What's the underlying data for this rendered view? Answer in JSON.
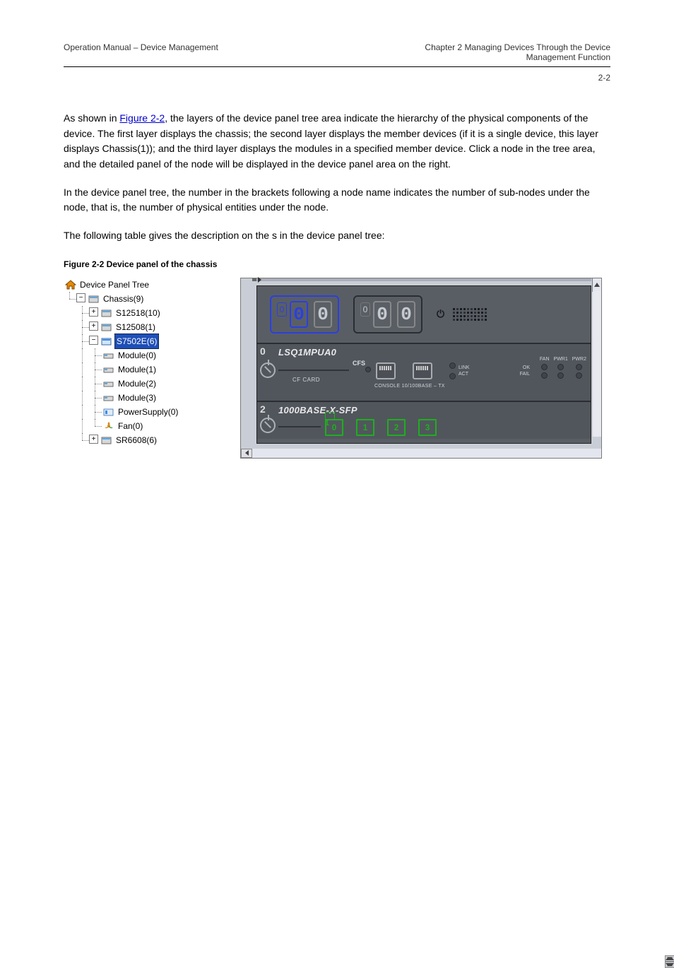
{
  "header": {
    "left": "Operation Manual – Device Management",
    "right_top": "Chapter 2 Managing Devices Through the Device",
    "right_bottom": "Management Function",
    "page": "2-2"
  },
  "paragraphs": {
    "p1_prefix": "As shown in ",
    "p1_link": "Figure 2-2",
    "p1_suffix": ", the layers of the device panel tree area indicate the hierarchy of the physical components of the device. The first layer displays the chassis; the second layer displays the member devices (if it is a single device, this layer displays Chassis(1)); and the third layer displays the modules in a specified member device. Click a node in the tree area, and the detailed panel of the node will be displayed in the device panel area on the right.",
    "p2": "In the device panel tree, the number in the brackets following a node name indicates the number of sub-nodes under the node, that is, the number of physical entities under the node.",
    "p3": "The following table gives the description on the s in the device panel tree:"
  },
  "figure": {
    "caption": "Figure 2-2 Device panel of the chassis",
    "tree": {
      "root": "Device Panel Tree",
      "chassis": "Chassis(9)",
      "members": [
        {
          "label": "S12518(10)",
          "expanded": false
        },
        {
          "label": "S12508(1)",
          "expanded": false
        },
        {
          "label": "S7502E(6)",
          "expanded": true,
          "selected": true,
          "children": [
            "Module(0)",
            "Module(1)",
            "Module(2)",
            "Module(3)",
            "PowerSupply(0)",
            "Fan(0)"
          ]
        },
        {
          "label": "SR6608(6)",
          "expanded": false
        }
      ]
    },
    "panel": {
      "slot0_num": "0",
      "slot0_title": "LSQ1MPUA0",
      "cfs": "CFS",
      "cfcard": "CF CARD",
      "console": "CONSOLE 10/100BASE – TX",
      "link": "LINK",
      "act": "ACT",
      "ok": "OK",
      "fail": "FAIL",
      "fan": "FAN",
      "pwr1": "PWR1",
      "pwr2": "PWR2",
      "slot2_num": "2",
      "slot2_title": "1000BASE-X-SFP",
      "sfp": [
        "0",
        "1",
        "2",
        "3"
      ],
      "sfp_mini": "1",
      "seg_digit": "0"
    }
  }
}
